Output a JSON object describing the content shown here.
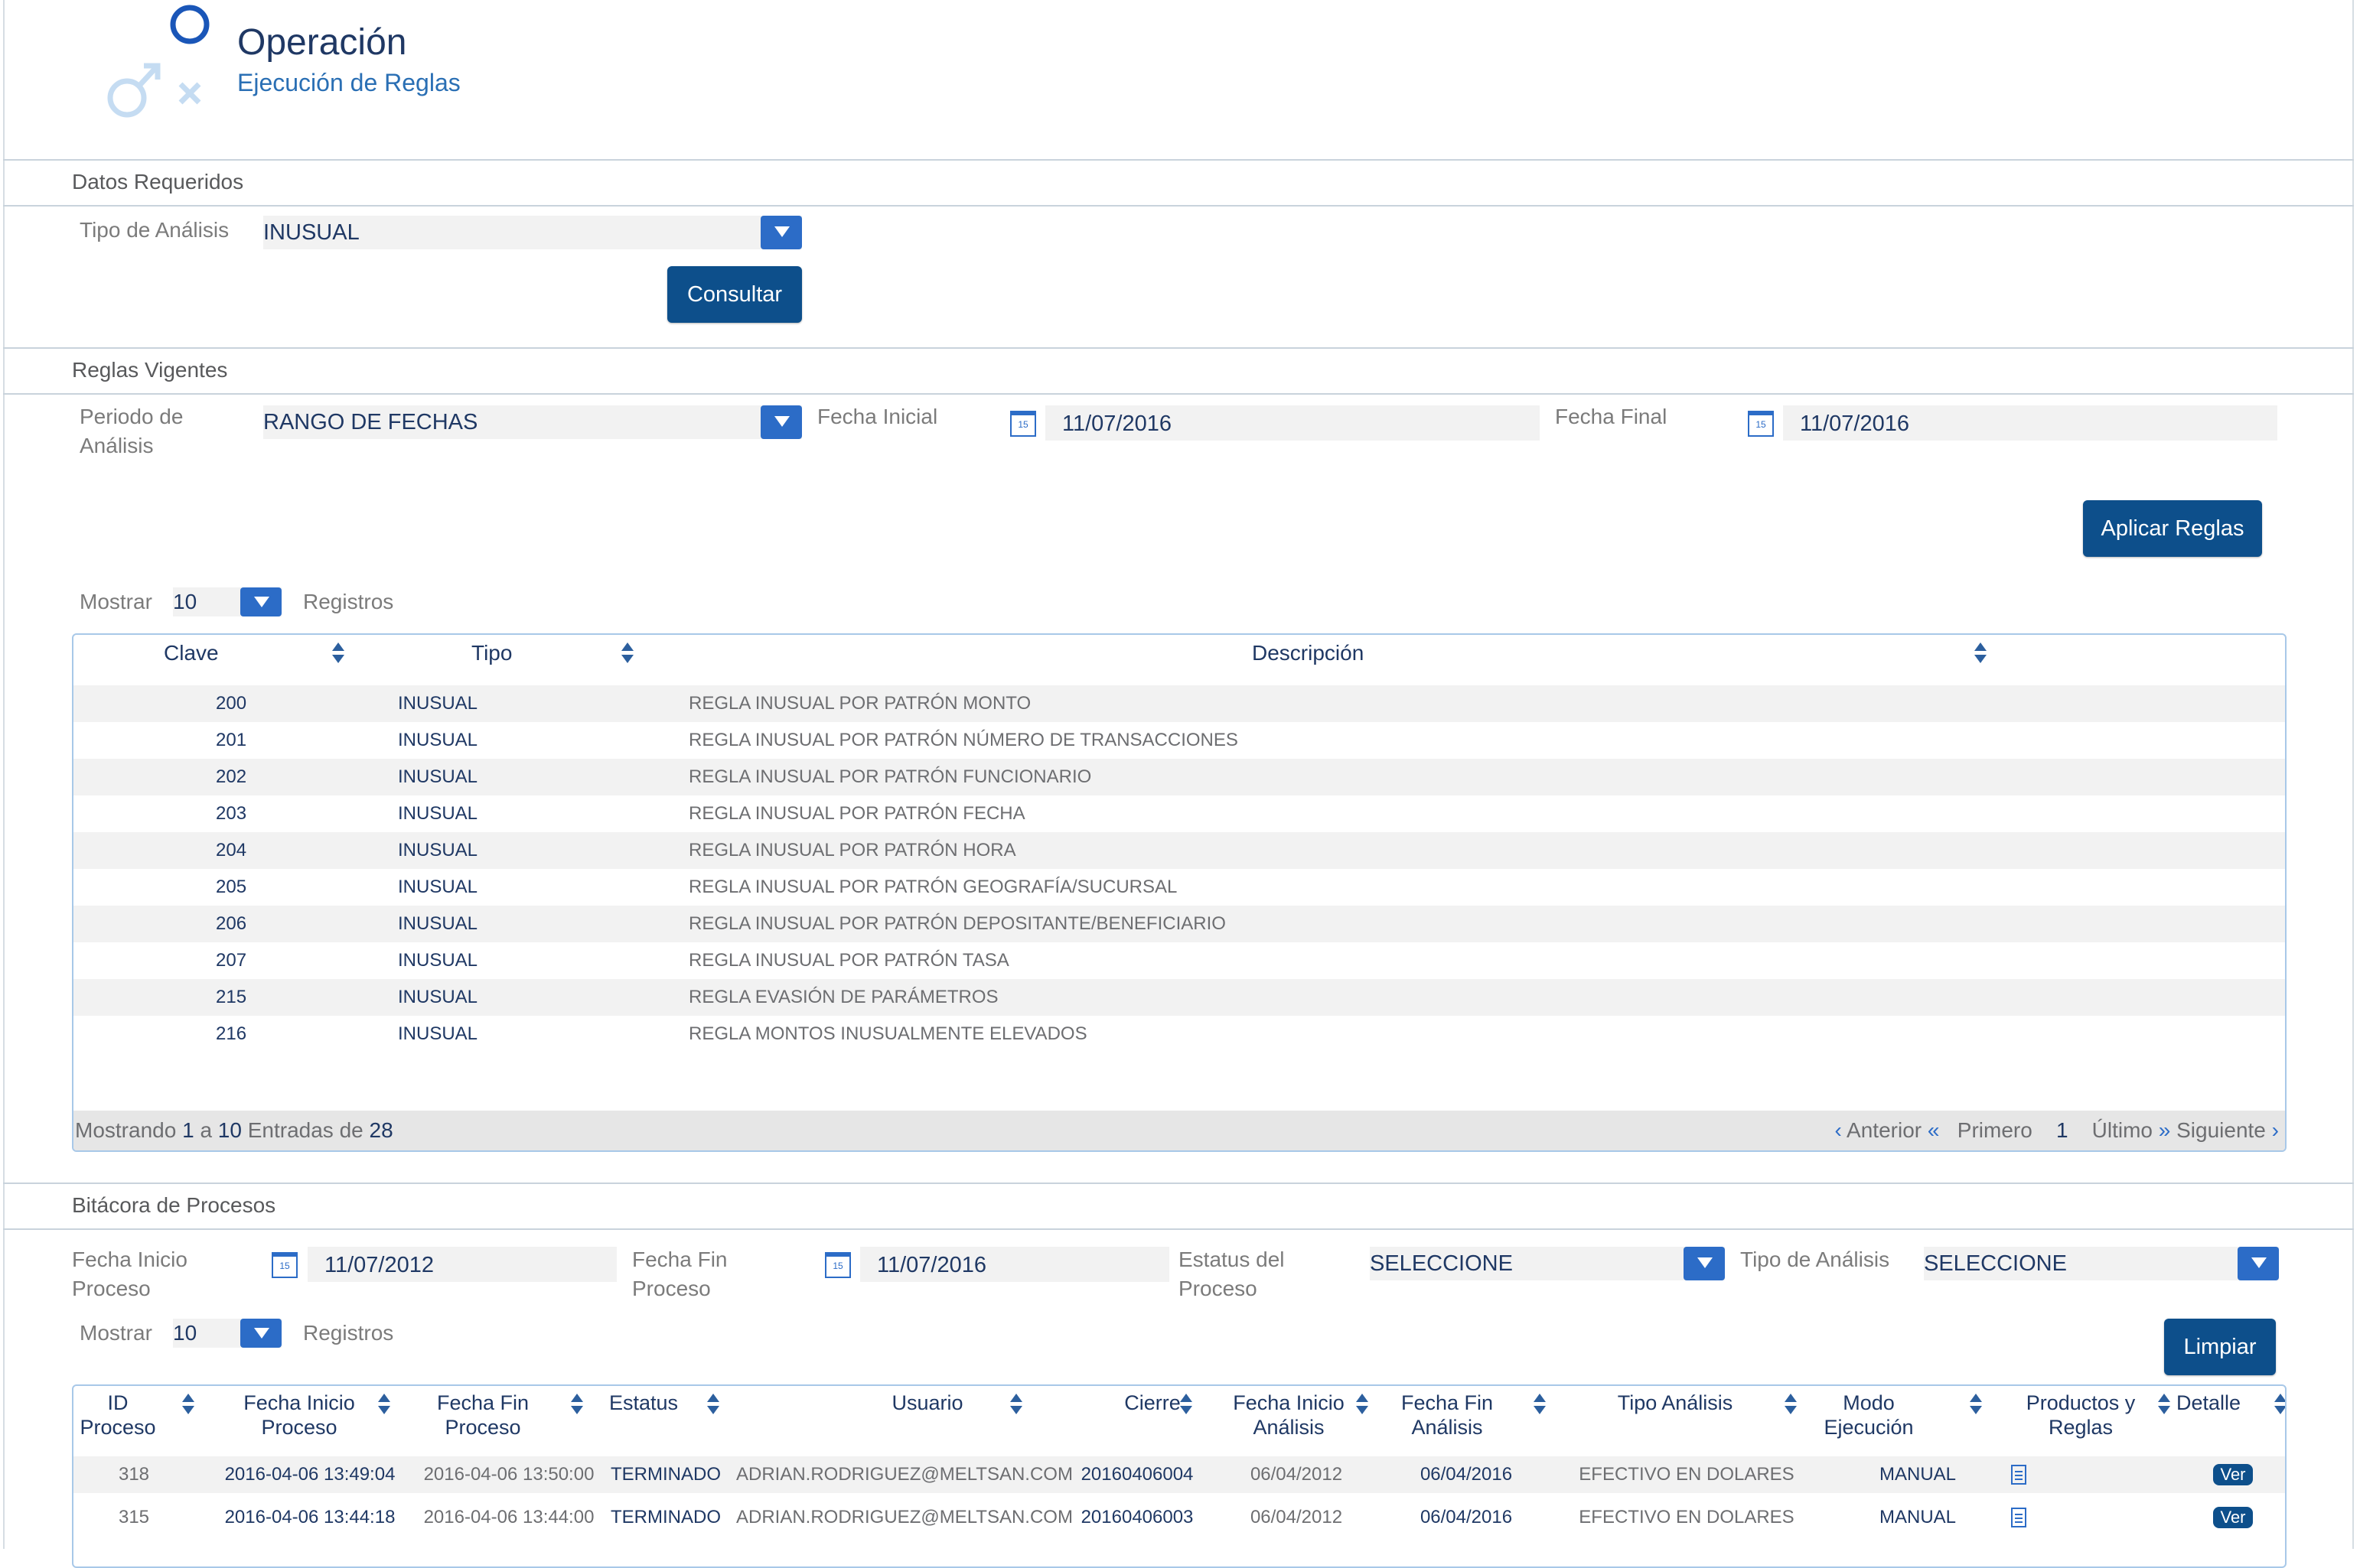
{
  "header": {
    "title": "Operación",
    "subtitle": "Ejecución de Reglas"
  },
  "colors": {
    "accent": "#0d4f8b",
    "dropdown_blue": "#2c6cc7",
    "title_navy": "#1f3864"
  },
  "datos_requeridos": {
    "section_title": "Datos Requeridos",
    "tipo_analisis_label": "Tipo de Análisis",
    "tipo_analisis_value": "INUSUAL",
    "consultar_label": "Consultar"
  },
  "reglas_vigentes": {
    "section_title": "Reglas Vigentes",
    "periodo_label": "Periodo de Análisis",
    "periodo_value": "RANGO DE FECHAS",
    "fecha_inicial_label": "Fecha Inicial",
    "fecha_inicial_value": "11/07/2016",
    "fecha_final_label": "Fecha Final",
    "fecha_final_value": "11/07/2016",
    "calendar_glyph": "15",
    "aplicar_label": "Aplicar Reglas",
    "mostrar_label": "Mostrar",
    "mostrar_value": "10",
    "registros_label": "Registros",
    "columns": [
      "Clave",
      "Tipo",
      "Descripción"
    ],
    "rows": [
      {
        "clave": "200",
        "tipo": "INUSUAL",
        "descripcion": "REGLA INUSUAL POR PATRÓN MONTO"
      },
      {
        "clave": "201",
        "tipo": "INUSUAL",
        "descripcion": "REGLA INUSUAL POR PATRÓN NÚMERO DE TRANSACCIONES"
      },
      {
        "clave": "202",
        "tipo": "INUSUAL",
        "descripcion": "REGLA INUSUAL POR PATRÓN FUNCIONARIO"
      },
      {
        "clave": "203",
        "tipo": "INUSUAL",
        "descripcion": "REGLA INUSUAL POR PATRÓN FECHA"
      },
      {
        "clave": "204",
        "tipo": "INUSUAL",
        "descripcion": "REGLA INUSUAL POR PATRÓN HORA"
      },
      {
        "clave": "205",
        "tipo": "INUSUAL",
        "descripcion": "REGLA INUSUAL POR PATRÓN GEOGRAFÍA/SUCURSAL"
      },
      {
        "clave": "206",
        "tipo": "INUSUAL",
        "descripcion": "REGLA INUSUAL POR PATRÓN DEPOSITANTE/BENEFICIARIO"
      },
      {
        "clave": "207",
        "tipo": "INUSUAL",
        "descripcion": "REGLA INUSUAL POR PATRÓN TASA"
      },
      {
        "clave": "215",
        "tipo": "INUSUAL",
        "descripcion": "REGLA EVASIÓN DE PARÁMETROS"
      },
      {
        "clave": "216",
        "tipo": "INUSUAL",
        "descripcion": "REGLA MONTOS INUSUALMENTE ELEVADOS"
      }
    ],
    "footer": {
      "mostrando": "Mostrando",
      "from": "1",
      "a": "a",
      "to": "10",
      "entradas_de": "Entradas de",
      "total": "28",
      "anterior": "Anterior",
      "primero": "Primero",
      "page": "1",
      "ultimo": "Último",
      "siguiente": "Siguiente"
    }
  },
  "bitacora": {
    "section_title": "Bitácora de Procesos",
    "fecha_inicio_label": "Fecha Inicio Proceso",
    "fecha_inicio_value": "11/07/2012",
    "fecha_fin_label": "Fecha Fin Proceso",
    "fecha_fin_value": "11/07/2016",
    "estatus_label": "Estatus del Proceso",
    "estatus_value": "SELECCIONE",
    "tipo_label": "Tipo de Análisis",
    "tipo_value": "SELECCIONE",
    "mostrar_label": "Mostrar",
    "mostrar_value": "10",
    "registros_label": "Registros",
    "limpiar_label": "Limpiar",
    "columns": [
      "ID Proceso",
      "Fecha Inicio Proceso",
      "Fecha Fin Proceso",
      "Estatus",
      "Usuario",
      "Cierre",
      "Fecha Inicio Análisis",
      "Fecha Fin Análisis",
      "Tipo Análisis",
      "Modo Ejecución",
      "Productos y Reglas",
      "Detalle"
    ],
    "ver_label": "Ver",
    "rows": [
      {
        "id": "318",
        "inicio": "2016-04-06 13:49:04",
        "fin": "2016-04-06 13:50:00",
        "estatus": "TERMINADO",
        "usuario": "ADRIAN.RODRIGUEZ@MELTSAN.COM",
        "cierre": "20160406004",
        "inicio_analisis": "06/04/2012",
        "fin_analisis": "06/04/2016",
        "tipo": "EFECTIVO EN DOLARES",
        "modo": "MANUAL"
      },
      {
        "id": "315",
        "inicio": "2016-04-06 13:44:18",
        "fin": "2016-04-06 13:44:00",
        "estatus": "TERMINADO",
        "usuario": "ADRIAN.RODRIGUEZ@MELTSAN.COM",
        "cierre": "20160406003",
        "inicio_analisis": "06/04/2012",
        "fin_analisis": "06/04/2016",
        "tipo": "EFECTIVO EN DOLARES",
        "modo": "MANUAL"
      }
    ]
  }
}
